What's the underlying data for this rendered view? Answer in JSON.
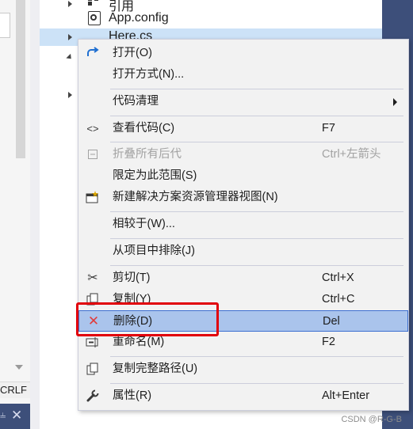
{
  "editor": {
    "line_ending": "CRLF",
    "pin_icon": "pin-icon",
    "close_icon": "close-icon"
  },
  "tree": {
    "ref_label": "引用",
    "appconfig_label": "App.config",
    "highlight_label": "Here.cs"
  },
  "menu": {
    "items": [
      {
        "label": "打开(O)",
        "shortcut": "",
        "icon": "open-redo-icon"
      },
      {
        "label": "打开方式(N)...",
        "shortcut": "",
        "icon": ""
      },
      {
        "label": "代码清理",
        "shortcut": "",
        "icon": "",
        "submenu": true
      },
      {
        "label": "查看代码(C)",
        "shortcut": "F7",
        "icon": "code-brackets-icon"
      },
      {
        "label": "折叠所有后代",
        "shortcut": "Ctrl+左箭头",
        "icon": "collapse-icon",
        "disabled": true
      },
      {
        "label": "限定为此范围(S)",
        "shortcut": "",
        "icon": ""
      },
      {
        "label": "新建解决方案资源管理器视图(N)",
        "shortcut": "",
        "icon": "new-view-icon"
      },
      {
        "label": "相较于(W)...",
        "shortcut": "",
        "icon": ""
      },
      {
        "label": "从项目中排除(J)",
        "shortcut": "",
        "icon": ""
      },
      {
        "label": "剪切(T)",
        "shortcut": "Ctrl+X",
        "icon": "scissors-icon"
      },
      {
        "label": "复制(Y)",
        "shortcut": "Ctrl+C",
        "icon": "copy-icon"
      },
      {
        "label": "删除(D)",
        "shortcut": "Del",
        "icon": "delete-x-icon",
        "hovered": true
      },
      {
        "label": "重命名(M)",
        "shortcut": "F2",
        "icon": "rename-icon"
      },
      {
        "label": "复制完整路径(U)",
        "shortcut": "",
        "icon": "copy-path-icon"
      },
      {
        "label": "属性(R)",
        "shortcut": "Alt+Enter",
        "icon": "wrench-icon"
      }
    ]
  },
  "watermark": "CSDN @R-G-B",
  "colors": {
    "hover_bg": "#aac4ec",
    "highlight_box": "#e1000a",
    "menu_bg": "#f2f2f2",
    "tool_window_blue": "#3d4f7a"
  }
}
